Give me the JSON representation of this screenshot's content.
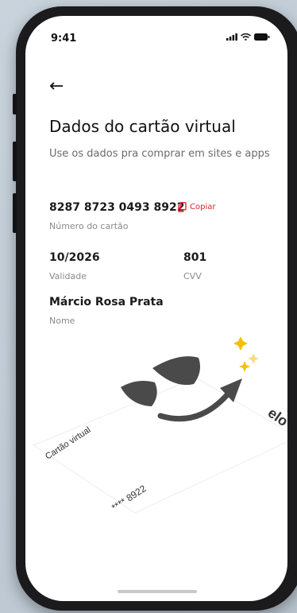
{
  "status_bar": {
    "time": "9:41"
  },
  "header": {
    "back_label": "←",
    "title": "Dados do cartão virtual",
    "subtitle": "Use os dados pra comprar em sites e apps"
  },
  "card_number": {
    "value": "8287 8723 0493 8922",
    "label": "Número do cartão",
    "copy_label": "Copiar"
  },
  "validity": {
    "value": "10/2026",
    "label": "Validade"
  },
  "cvv": {
    "value": "801",
    "label": "CVV"
  },
  "name": {
    "value": "Márcio Rosa Prata",
    "label": "Nome"
  },
  "illustration": {
    "card_label": "Cartão virtual",
    "card_last_digits": "**** 8922",
    "brand": "elo"
  },
  "colors": {
    "accent": "#e0242e",
    "text": "#1b1b1b",
    "muted": "#8a8a8a",
    "star": "#f2c200"
  }
}
